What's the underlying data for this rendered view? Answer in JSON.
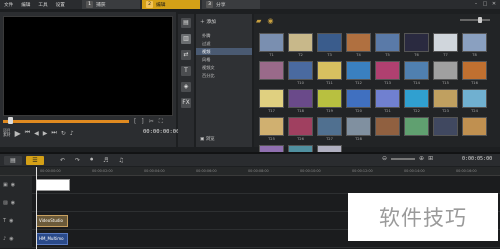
{
  "menu": [
    "文件",
    "编辑",
    "工具",
    "设置"
  ],
  "steps": [
    {
      "num": "1",
      "label": "捕获",
      "active": false
    },
    {
      "num": "2",
      "label": "编辑",
      "active": true
    },
    {
      "num": "3",
      "label": "分享",
      "active": false
    }
  ],
  "window_controls": [
    "–",
    "□",
    "✕"
  ],
  "preview": {
    "timecode": "00:00:00:00",
    "mode_labels": [
      "项目",
      "素材"
    ],
    "progress": 1.0
  },
  "library": {
    "add_label": "添加",
    "categories": [
      "扑腾",
      "过滤",
      "视频",
      "风格",
      "视频文",
      "百分比"
    ],
    "selected_category": 2,
    "browse_label": "浏览",
    "thumb_labels": [
      "T1",
      "T2",
      "T3",
      "T4",
      "T5",
      "T6",
      "T7",
      "T8",
      "",
      "T10",
      "T11",
      "T12",
      "T13",
      "T14",
      "T15",
      "T16",
      "T17",
      "T18",
      "T19",
      "T20",
      "T21",
      "T22",
      "T23",
      "T24",
      "T25",
      "T26",
      "T27",
      "T28",
      "",
      "",
      "",
      "",
      "",
      "",
      ""
    ]
  },
  "timeline": {
    "duration": "0:00:05:00",
    "ruler_ticks": [
      "00:00:00:00",
      "00:00:02:00",
      "00:00:04:00",
      "00:00:06:00",
      "00:00:08:00",
      "00:00:10:00",
      "00:00:12:00",
      "00:00:14:00",
      "00:00:16:00"
    ],
    "clips": [
      {
        "label": "",
        "track": 0
      },
      {
        "label": "VideoStudio",
        "track": 2
      },
      {
        "label": "HM_Multimo",
        "track": 3
      }
    ]
  },
  "watermark": "软件技巧",
  "colors": {
    "accent": "#d4a017",
    "panel": "#2a2c2f",
    "selection": "#4a5a72"
  }
}
